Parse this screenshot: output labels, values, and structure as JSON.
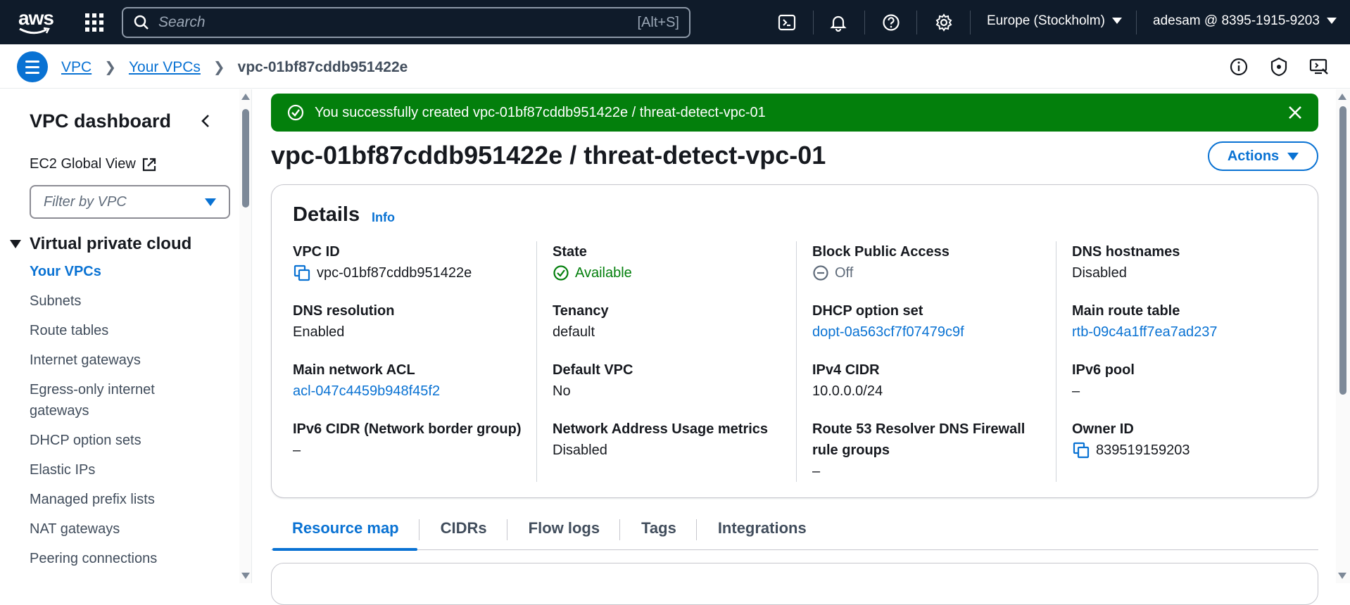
{
  "topnav": {
    "logo_text": "aws",
    "search_placeholder": "Search",
    "search_shortcut": "[Alt+S]",
    "region": "Europe (Stockholm)",
    "account": "adesam @ 8395-1915-9203"
  },
  "breadcrumb": {
    "items": [
      "VPC",
      "Your VPCs"
    ],
    "current": "vpc-01bf87cddb951422e"
  },
  "sidebar": {
    "title": "VPC dashboard",
    "ec2_global_view": "EC2 Global View",
    "filter_placeholder": "Filter by VPC",
    "section": "Virtual private cloud",
    "items": [
      "Your VPCs",
      "Subnets",
      "Route tables",
      "Internet gateways",
      "Egress-only internet gateways",
      "DHCP option sets",
      "Elastic IPs",
      "Managed prefix lists",
      "NAT gateways",
      "Peering connections"
    ],
    "active_index": 0
  },
  "flash": {
    "message": "You successfully created vpc-01bf87cddb951422e / threat-detect-vpc-01",
    "color": "#037f0c"
  },
  "page": {
    "title": "vpc-01bf87cddb951422e / threat-detect-vpc-01",
    "actions_label": "Actions"
  },
  "details": {
    "heading": "Details",
    "info_link": "Info",
    "columns": [
      [
        {
          "label": "VPC ID",
          "value": "vpc-01bf87cddb951422e",
          "kind": "copy"
        },
        {
          "label": "DNS resolution",
          "value": "Enabled",
          "kind": "text"
        },
        {
          "label": "Main network ACL",
          "value": "acl-047c4459b948f45f2",
          "kind": "link"
        },
        {
          "label": "IPv6 CIDR (Network border group)",
          "value": "–",
          "kind": "text"
        }
      ],
      [
        {
          "label": "State",
          "value": "Available",
          "kind": "ok"
        },
        {
          "label": "Tenancy",
          "value": "default",
          "kind": "text"
        },
        {
          "label": "Default VPC",
          "value": "No",
          "kind": "text"
        },
        {
          "label": "Network Address Usage metrics",
          "value": "Disabled",
          "kind": "text"
        }
      ],
      [
        {
          "label": "Block Public Access",
          "value": "Off",
          "kind": "off"
        },
        {
          "label": "DHCP option set",
          "value": "dopt-0a563cf7f07479c9f",
          "kind": "link"
        },
        {
          "label": "IPv4 CIDR",
          "value": "10.0.0.0/24",
          "kind": "text"
        },
        {
          "label": "Route 53 Resolver DNS Firewall rule groups",
          "value": "–",
          "kind": "text"
        }
      ],
      [
        {
          "label": "DNS hostnames",
          "value": "Disabled",
          "kind": "text"
        },
        {
          "label": "Main route table",
          "value": "rtb-09c4a1ff7ea7ad237",
          "kind": "link"
        },
        {
          "label": "IPv6 pool",
          "value": "–",
          "kind": "text"
        },
        {
          "label": "Owner ID",
          "value": "839519159203",
          "kind": "copy"
        }
      ]
    ]
  },
  "tabs": [
    "Resource map",
    "CIDRs",
    "Flow logs",
    "Tags",
    "Integrations"
  ],
  "active_tab": 0,
  "colors": {
    "nav_bg": "#0f1b2a",
    "accent": "#0972d3",
    "success": "#037f0c"
  }
}
